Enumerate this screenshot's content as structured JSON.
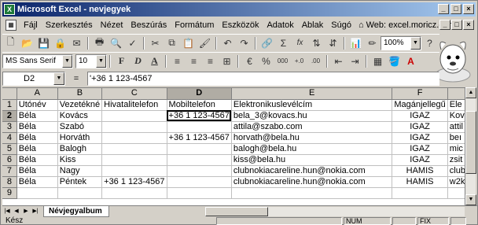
{
  "window": {
    "title": "Microsoft Excel - nevjegyek",
    "app_icon": "excel-icon"
  },
  "window_buttons": [
    "_",
    "□",
    "×"
  ],
  "menu": {
    "items": [
      {
        "label": "Fájl",
        "accel": "F"
      },
      {
        "label": "Szerkesztés",
        "accel": "S"
      },
      {
        "label": "Nézet",
        "accel": "N"
      },
      {
        "label": "Beszúrás",
        "accel": "B"
      },
      {
        "label": "Formátum",
        "accel": "r"
      },
      {
        "label": "Eszközök",
        "accel": "E"
      },
      {
        "label": "Adatok",
        "accel": "d"
      },
      {
        "label": "Ablak",
        "accel": "A"
      },
      {
        "label": "Súgó",
        "accel": "S"
      }
    ],
    "web_label": "Web: excel.moricz.com"
  },
  "toolbar": {
    "zoom": "100%",
    "font_name": "MS Sans Serif",
    "font_size": "10",
    "bold": "F",
    "italic": "D",
    "underline": "A",
    "sum": "Σ",
    "fx": "fx",
    "percent": "%",
    "thousands": "000"
  },
  "formula_bar": {
    "name_box": "D2",
    "equals": "=",
    "content": "'+36 1 123-4567"
  },
  "grid": {
    "columns": [
      "A",
      "B",
      "C",
      "D",
      "E",
      "F",
      ""
    ],
    "selected_column": "D",
    "selected_row": "2",
    "rows": [
      {
        "n": "1",
        "cells": [
          "Utónév",
          "Vezetékné",
          "Hivatalitelefon",
          "Mobiltelefon",
          "Elektronikuslevélcím",
          "Magánjellegű",
          "Ele"
        ]
      },
      {
        "n": "2",
        "cells": [
          "Béla",
          "Kovács",
          "",
          "+36 1 123-4567",
          "bela_3@kovacs.hu",
          "IGAZ",
          "Kov"
        ]
      },
      {
        "n": "3",
        "cells": [
          "Béla",
          "Szabó",
          "",
          "",
          "attila@szabo.com",
          "IGAZ",
          "attil"
        ]
      },
      {
        "n": "4",
        "cells": [
          "Béla",
          "Horváth",
          "",
          "+36 1 123-4567",
          "horvath@bela.hu",
          "IGAZ",
          "beı"
        ]
      },
      {
        "n": "5",
        "cells": [
          "Béla",
          "Balogh",
          "",
          "",
          "balogh@bela.hu",
          "IGAZ",
          "mic"
        ]
      },
      {
        "n": "6",
        "cells": [
          "Béla",
          "Kiss",
          "",
          "",
          "kiss@bela.hu",
          "IGAZ",
          "zsit"
        ]
      },
      {
        "n": "7",
        "cells": [
          "Béla",
          "Nagy",
          "",
          "",
          "clubnokiacareline.hun@nokia.com",
          "HAMIS",
          "club"
        ]
      },
      {
        "n": "8",
        "cells": [
          "Béla",
          "Péntek",
          "+36 1 123-4567",
          "",
          "clubnokiacareline.hun@nokia.com",
          "HAMIS",
          "w2k"
        ]
      },
      {
        "n": "9",
        "cells": [
          "",
          "",
          "",
          "",
          "",
          "",
          ""
        ]
      }
    ]
  },
  "sheet_tabs": {
    "active": "Névjegyalbum"
  },
  "status": {
    "ready": "Kész",
    "num": "NUM",
    "fix": "FIX"
  }
}
